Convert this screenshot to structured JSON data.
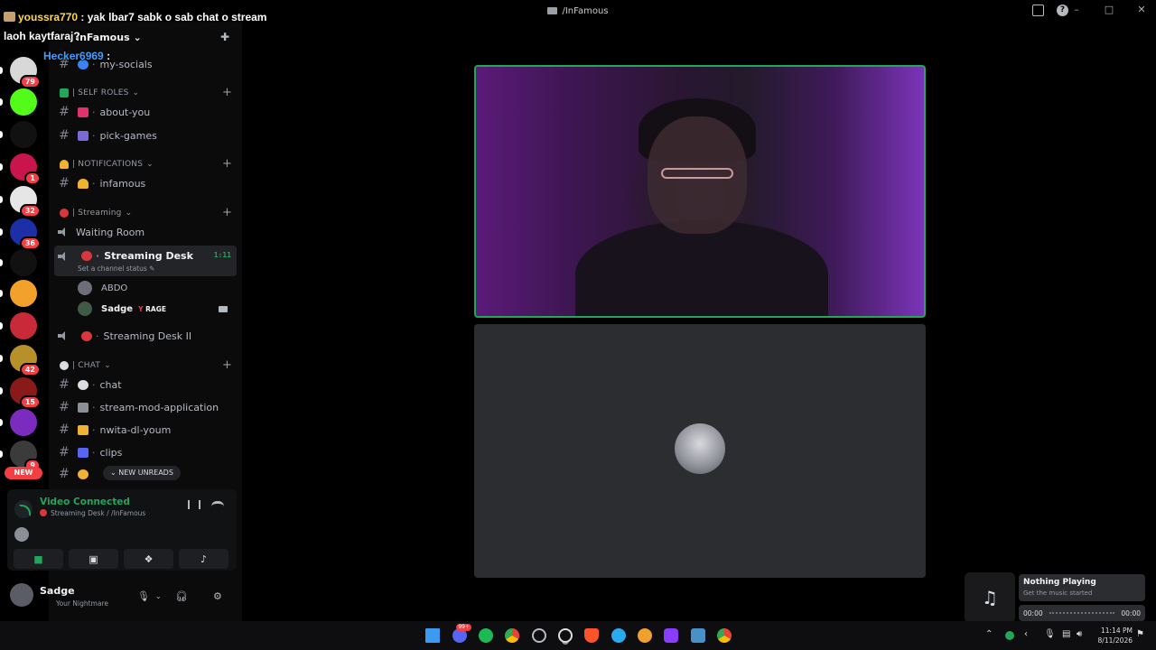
{
  "window": {
    "title": "/InFamous"
  },
  "overlay": {
    "line1_user": "youssra770",
    "line1_text": " : yak lbar7 sabk o sab chat o stream",
    "line2_text": "laoh kaytfaraj?",
    "line3_user": "Hecker6969",
    "line3_text": " :"
  },
  "server": {
    "name": "InFamous"
  },
  "rail": [
    {
      "icon": "server-icon",
      "badge": "79",
      "color": "#d8d8d8"
    },
    {
      "icon": "kick-icon",
      "badge": "",
      "color": "#53fc18"
    },
    {
      "icon": "infamous-icon",
      "badge": "",
      "color": "#111111"
    },
    {
      "icon": "ea-icon",
      "badge": "1",
      "color": "#c9154b"
    },
    {
      "icon": "server-icon",
      "badge": "32",
      "color": "#e6e6e6"
    },
    {
      "icon": "x-icon",
      "badge": "36",
      "color": "#1d2fa6"
    },
    {
      "icon": "n-icon",
      "badge": "",
      "color": "#111111"
    },
    {
      "icon": "server-icon",
      "badge": "",
      "color": "#f4a12c"
    },
    {
      "icon": "haven-icon",
      "badge": "",
      "color": "#c82a3a"
    },
    {
      "icon": "server-icon",
      "badge": "42",
      "color": "#b8902a"
    },
    {
      "icon": "server-icon",
      "badge": "15",
      "color": "#8a1a1a"
    },
    {
      "icon": "vv-icon",
      "badge": "",
      "color": "#7b2cbf"
    },
    {
      "icon": "server-icon",
      "badge": "9",
      "color": "#3b3b3b"
    }
  ],
  "rail_new": "NEW",
  "channels": {
    "my_socials": "my-socials",
    "cat_self_roles": "| SELF ROLES",
    "about_you": "about-you",
    "pick_games": "pick-games",
    "cat_notifications": "| NOTIFICATIONS",
    "infamous": "infamous",
    "cat_streaming": "| Streaming",
    "waiting_room": "Waiting Room",
    "streaming_desk": "Streaming Desk",
    "streaming_desk_timer": "1:11",
    "streaming_desk_status": "Set a channel status",
    "user_abdo": "ABDO",
    "user_sadge": "Sadge",
    "rage_tag": "RAGE",
    "streaming_desk_ii": "Streaming Desk II",
    "cat_chat": "| CHAT",
    "chat": "chat",
    "stream_mod": "stream-mod-application",
    "nwita": "nwita-dl-youm",
    "clips": "clips",
    "new_unreads": "NEW UNREADS"
  },
  "voice": {
    "title": "Video Connected",
    "subtitle": "Streaming Desk / /InFamous"
  },
  "user": {
    "name": "Sadge",
    "status": "Your Nightmare"
  },
  "now_playing": {
    "title": "Nothing Playing",
    "subtitle": "Get the music started",
    "time_start": "00:00",
    "time_end": "00:00"
  },
  "taskbar": {
    "time": "11:14 PM",
    "date": "8/11/2026",
    "discord_badge": "99+"
  }
}
